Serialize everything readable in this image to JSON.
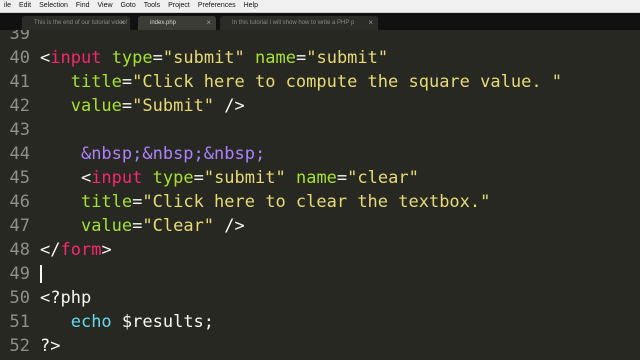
{
  "menubar": {
    "items": [
      "ile",
      "Edit",
      "Selection",
      "Find",
      "View",
      "Goto",
      "Tools",
      "Project",
      "Preferences",
      "Help"
    ]
  },
  "tabs": [
    {
      "label": "This is the end of our tutorial video!",
      "active": false
    },
    {
      "label": "index.php",
      "active": true
    },
    {
      "label": "In this tutorial I will show how to write a PHP p",
      "active": false
    }
  ],
  "editor": {
    "colors": {
      "background": "#272822",
      "tag": "#f92672",
      "attribute": "#a6e22e",
      "string": "#e6db74",
      "entity": "#ae81ff",
      "keyword": "#66d9ef"
    },
    "lines": [
      {
        "num": "39",
        "tokens": []
      },
      {
        "num": "40",
        "tokens": [
          {
            "t": "<",
            "c": "p"
          },
          {
            "t": "input",
            "c": "t"
          },
          {
            "t": " ",
            "c": "p"
          },
          {
            "t": "type",
            "c": "a"
          },
          {
            "t": "=",
            "c": "p"
          },
          {
            "t": "\"submit\"",
            "c": "s"
          },
          {
            "t": " ",
            "c": "p"
          },
          {
            "t": "name",
            "c": "a"
          },
          {
            "t": "=",
            "c": "p"
          },
          {
            "t": "\"submit\"",
            "c": "s"
          }
        ]
      },
      {
        "num": "41",
        "tokens": [
          {
            "t": "   ",
            "c": "p"
          },
          {
            "t": "title",
            "c": "a"
          },
          {
            "t": "=",
            "c": "p"
          },
          {
            "t": "\"Click here to compute the square value. \"",
            "c": "s"
          }
        ]
      },
      {
        "num": "42",
        "tokens": [
          {
            "t": "   ",
            "c": "p"
          },
          {
            "t": "value",
            "c": "a"
          },
          {
            "t": "=",
            "c": "p"
          },
          {
            "t": "\"Submit\"",
            "c": "s"
          },
          {
            "t": " />",
            "c": "p"
          }
        ]
      },
      {
        "num": "43",
        "tokens": []
      },
      {
        "num": "44",
        "tokens": [
          {
            "t": "    ",
            "c": "p"
          },
          {
            "t": "&nbsp;&nbsp;&nbsp;",
            "c": "e"
          }
        ]
      },
      {
        "num": "45",
        "tokens": [
          {
            "t": "    <",
            "c": "p"
          },
          {
            "t": "input",
            "c": "t"
          },
          {
            "t": " ",
            "c": "p"
          },
          {
            "t": "type",
            "c": "a"
          },
          {
            "t": "=",
            "c": "p"
          },
          {
            "t": "\"submit\"",
            "c": "s"
          },
          {
            "t": " ",
            "c": "p"
          },
          {
            "t": "name",
            "c": "a"
          },
          {
            "t": "=",
            "c": "p"
          },
          {
            "t": "\"clear\"",
            "c": "s"
          }
        ]
      },
      {
        "num": "46",
        "tokens": [
          {
            "t": "    ",
            "c": "p"
          },
          {
            "t": "title",
            "c": "a"
          },
          {
            "t": "=",
            "c": "p"
          },
          {
            "t": "\"Click here to clear the textbox.\"",
            "c": "s"
          }
        ]
      },
      {
        "num": "47",
        "tokens": [
          {
            "t": "    ",
            "c": "p"
          },
          {
            "t": "value",
            "c": "a"
          },
          {
            "t": "=",
            "c": "p"
          },
          {
            "t": "\"Clear\"",
            "c": "s"
          },
          {
            "t": " />",
            "c": "p"
          }
        ]
      },
      {
        "num": "48",
        "tokens": [
          {
            "t": "</",
            "c": "p"
          },
          {
            "t": "form",
            "c": "t"
          },
          {
            "t": ">",
            "c": "p"
          }
        ]
      },
      {
        "num": "49",
        "tokens": [],
        "caret": true
      },
      {
        "num": "50",
        "tokens": [
          {
            "t": "<?php",
            "c": "p"
          }
        ]
      },
      {
        "num": "51",
        "tokens": [
          {
            "t": "   ",
            "c": "p"
          },
          {
            "t": "echo",
            "c": "k"
          },
          {
            "t": " $results;",
            "c": "p"
          }
        ]
      },
      {
        "num": "52",
        "tokens": [
          {
            "t": "?>",
            "c": "p"
          }
        ]
      }
    ]
  }
}
